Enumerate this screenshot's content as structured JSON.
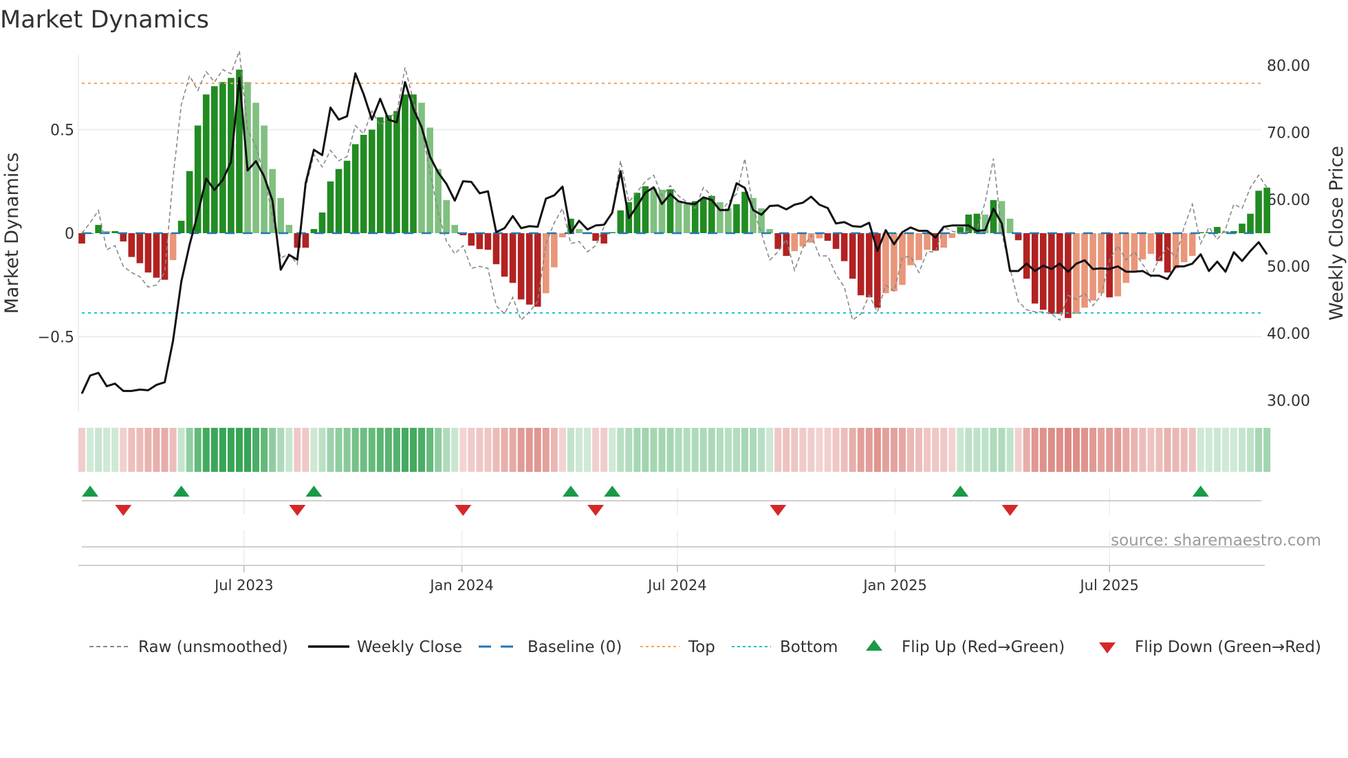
{
  "chart_data": {
    "type": "bar",
    "title": "Market Dynamics",
    "ylabel_left": "Market Dynamics",
    "ylabel_right": "Weekly Close Price",
    "first_week": "2023-02-14",
    "frequency": "weekly",
    "ylim_left": [
      -0.78,
      0.86
    ],
    "ylim_right": [
      28.5,
      82
    ],
    "left_ticks": [
      {
        "v": 0.5,
        "label": "0.5"
      },
      {
        "v": 0,
        "label": "0"
      },
      {
        "v": -0.5,
        "label": "−0.5"
      }
    ],
    "right_ticks": [
      {
        "v": 80,
        "label": "80.00"
      },
      {
        "v": 70,
        "label": "70.00"
      },
      {
        "v": 60,
        "label": "60.00"
      },
      {
        "v": 50,
        "label": "50.00"
      },
      {
        "v": 40,
        "label": "40.00"
      },
      {
        "v": 30,
        "label": "30.00"
      }
    ],
    "x_ticks": [
      {
        "date": "2023-07-01",
        "label": "Jul 2023"
      },
      {
        "date": "2024-01-01",
        "label": "Jan 2024"
      },
      {
        "date": "2024-07-01",
        "label": "Jul 2024"
      },
      {
        "date": "2025-01-01",
        "label": "Jan 2025"
      },
      {
        "date": "2025-07-01",
        "label": "Jul 2025"
      }
    ],
    "top_level": 0.724,
    "bottom_level": -0.385,
    "baseline": 0,
    "dynamics": [
      -0.05,
      0.0,
      0.04,
      0.01,
      0.01,
      -0.04,
      -0.115,
      -0.145,
      -0.19,
      -0.215,
      -0.225,
      -0.13,
      0.06,
      0.3,
      0.52,
      0.67,
      0.71,
      0.73,
      0.75,
      0.79,
      0.73,
      0.63,
      0.52,
      0.31,
      0.17,
      0.04,
      -0.07,
      -0.07,
      0.02,
      0.1,
      0.25,
      0.31,
      0.35,
      0.43,
      0.475,
      0.5,
      0.56,
      0.57,
      0.59,
      0.67,
      0.67,
      0.63,
      0.51,
      0.31,
      0.16,
      0.04,
      -0.01,
      -0.06,
      -0.077,
      -0.08,
      -0.15,
      -0.21,
      -0.24,
      -0.32,
      -0.345,
      -0.355,
      -0.29,
      -0.165,
      -0.02,
      0.07,
      0.02,
      0.005,
      -0.037,
      -0.05,
      0.005,
      0.11,
      0.15,
      0.195,
      0.227,
      0.215,
      0.21,
      0.212,
      0.155,
      0.14,
      0.155,
      0.17,
      0.18,
      0.15,
      0.12,
      0.14,
      0.2,
      0.17,
      0.12,
      0.02,
      -0.076,
      -0.11,
      -0.087,
      -0.064,
      -0.046,
      -0.025,
      -0.037,
      -0.076,
      -0.135,
      -0.22,
      -0.3,
      -0.31,
      -0.36,
      -0.29,
      -0.28,
      -0.25,
      -0.155,
      -0.13,
      -0.08,
      -0.084,
      -0.07,
      -0.023,
      0.03,
      0.09,
      0.094,
      0.09,
      0.16,
      0.155,
      0.07,
      -0.034,
      -0.22,
      -0.34,
      -0.37,
      -0.39,
      -0.39,
      -0.41,
      -0.39,
      -0.36,
      -0.325,
      -0.29,
      -0.31,
      -0.305,
      -0.24,
      -0.18,
      -0.127,
      -0.1,
      -0.135,
      -0.19,
      -0.17,
      -0.14,
      -0.11,
      0.005,
      0.005,
      0.03,
      0.01,
      0.01,
      0.046,
      0.094,
      0.205,
      0.22
    ],
    "raw": [
      0.0,
      0.05,
      0.11,
      -0.08,
      -0.06,
      -0.16,
      -0.19,
      -0.21,
      -0.26,
      -0.25,
      -0.19,
      0.27,
      0.62,
      0.76,
      0.69,
      0.78,
      0.73,
      0.79,
      0.77,
      0.88,
      0.5,
      0.42,
      0.28,
      0.08,
      -0.12,
      -0.1,
      -0.15,
      0.22,
      0.38,
      0.32,
      0.4,
      0.35,
      0.37,
      0.52,
      0.48,
      0.59,
      0.52,
      0.56,
      0.58,
      0.8,
      0.64,
      0.5,
      0.3,
      0.1,
      -0.04,
      -0.1,
      -0.06,
      -0.17,
      -0.16,
      -0.17,
      -0.35,
      -0.39,
      -0.31,
      -0.42,
      -0.38,
      -0.33,
      -0.05,
      0.05,
      0.12,
      -0.05,
      -0.04,
      -0.09,
      -0.06,
      0.03,
      0.1,
      0.35,
      0.15,
      0.2,
      0.25,
      0.28,
      0.18,
      0.23,
      0.18,
      0.15,
      0.12,
      0.22,
      0.18,
      0.1,
      0.15,
      0.19,
      0.36,
      0.12,
      0.0,
      -0.13,
      -0.09,
      -0.03,
      -0.18,
      -0.07,
      -0.01,
      -0.11,
      -0.11,
      -0.2,
      -0.26,
      -0.42,
      -0.39,
      -0.3,
      -0.38,
      -0.25,
      -0.28,
      -0.12,
      -0.11,
      -0.19,
      -0.09,
      -0.09,
      0.03,
      0.01,
      0.0,
      0.01,
      0.02,
      0.15,
      0.36,
      0.0,
      -0.17,
      -0.33,
      -0.37,
      -0.38,
      -0.38,
      -0.39,
      -0.42,
      -0.3,
      -0.32,
      -0.29,
      -0.35,
      -0.3,
      -0.13,
      -0.06,
      -0.13,
      -0.09,
      -0.15,
      -0.21,
      -0.12,
      -0.07,
      -0.12,
      0.03,
      0.14,
      -0.05,
      0.03,
      -0.03,
      0.02,
      0.14,
      0.12,
      0.22,
      0.28,
      0.22
    ],
    "weekly_close": [
      31.0,
      33.7,
      34.1,
      32.1,
      32.5,
      31.4,
      31.4,
      31.6,
      31.5,
      32.3,
      32.7,
      38.9,
      47.7,
      53.2,
      57.9,
      63.1,
      61.4,
      62.9,
      65.6,
      78.1,
      64.3,
      65.7,
      63.4,
      59.8,
      49.5,
      51.7,
      51.0,
      62.4,
      67.4,
      66.6,
      73.7,
      71.9,
      72.4,
      78.8,
      75.7,
      71.9,
      75.0,
      71.9,
      71.5,
      77.5,
      73.5,
      70.8,
      66.4,
      64.0,
      62.3,
      59.8,
      62.7,
      62.6,
      60.9,
      61.2,
      55.1,
      55.7,
      57.5,
      55.7,
      56.0,
      55.9,
      60.1,
      60.6,
      61.9,
      55.0,
      56.8,
      55.5,
      56.1,
      56.2,
      58.0,
      64.2,
      57.2,
      59.0,
      61.0,
      61.8,
      59.3,
      60.8,
      59.7,
      59.4,
      59.3,
      60.3,
      59.9,
      58.4,
      58.4,
      62.4,
      61.7,
      58.4,
      57.7,
      59.0,
      59.1,
      58.5,
      59.2,
      59.5,
      60.4,
      59.2,
      58.7,
      56.4,
      56.6,
      56.0,
      55.9,
      56.5,
      52.3,
      55.4,
      53.3,
      55.1,
      55.8,
      55.3,
      55.3,
      54.3,
      55.9,
      56.1,
      56.1,
      56.1,
      55.3,
      55.4,
      58.6,
      56.4,
      49.3,
      49.3,
      50.4,
      49.3,
      50.1,
      49.6,
      50.4,
      49.2,
      50.4,
      50.9,
      49.6,
      49.7,
      49.6,
      50.0,
      49.2,
      49.2,
      49.3,
      48.6,
      48.6,
      48.1,
      50.0,
      50.0,
      50.4,
      51.8,
      49.3,
      50.7,
      49.2,
      52.1,
      50.8,
      52.3,
      53.6,
      51.8
    ],
    "flip_up_dates": [
      "2023-02-24",
      "2023-05-12",
      "2023-09-01",
      "2024-04-05",
      "2024-05-10",
      "2025-02-28",
      "2025-09-19"
    ],
    "flip_down_dates": [
      "2023-03-24",
      "2023-08-18",
      "2024-01-05",
      "2024-04-26",
      "2024-09-27",
      "2025-04-11"
    ],
    "colors": {
      "up_strong": "#228b22",
      "up_weak": "#80c080",
      "down_strong": "#b22222",
      "down_weak": "#e9967a",
      "close": "#111111",
      "raw": "#888888",
      "baseline": "#1f77b4",
      "top": "#f4a460",
      "bottom": "#17becf",
      "flip_up": "#1a9a47",
      "flip_down": "#d62728",
      "heat_green": "#2ca04c",
      "heat_red": "#c9463d"
    },
    "legend": {
      "raw": "Raw (unsmoothed)",
      "close": "Weekly Close",
      "baseline": "Baseline (0)",
      "top": "Top",
      "bottom": "Bottom",
      "flip_up": "Flip Up (Red→Green)",
      "flip_down": "Flip Down (Green→Red)"
    },
    "source": "source: sharemaestro.com"
  }
}
